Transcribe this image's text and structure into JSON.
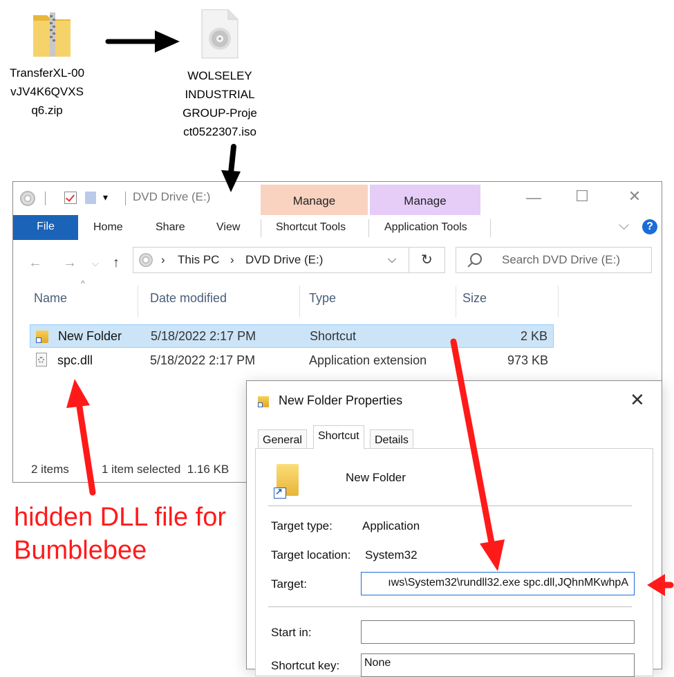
{
  "desktop": {
    "zip_label_lines": [
      "TransferXL-00",
      "vJV4K6QVXS",
      "q6.zip"
    ],
    "iso_label_lines": [
      "WOLSELEY",
      "INDUSTRIAL",
      "GROUP-Proje",
      "ct0522307.iso"
    ]
  },
  "explorer": {
    "title": "DVD Drive (E:)",
    "context_tabs": [
      {
        "header": "Manage",
        "tab": "Shortcut Tools",
        "color": "#f9d2c0"
      },
      {
        "header": "Manage",
        "tab": "Application Tools",
        "color": "#e6cdf7"
      }
    ],
    "ribbon_tabs": [
      "File",
      "Home",
      "Share",
      "View"
    ],
    "breadcrumb": [
      "This PC",
      "DVD Drive (E:)"
    ],
    "search_placeholder": "Search DVD Drive (E:)",
    "columns": [
      "Name",
      "Date modified",
      "Type",
      "Size"
    ],
    "files": [
      {
        "name": "New Folder",
        "date": "5/18/2022 2:17 PM",
        "type": "Shortcut",
        "size": "2 KB",
        "selected": true,
        "icon": "shortcut-folder-icon"
      },
      {
        "name": "spc.dll",
        "date": "5/18/2022 2:17 PM",
        "type": "Application extension",
        "size": "973 KB",
        "selected": false,
        "icon": "dll-file-icon"
      }
    ],
    "status": {
      "items": "2 items",
      "selected": "1 item selected  1.16 KB"
    }
  },
  "dialog": {
    "title": "New Folder Properties",
    "tabs": [
      "General",
      "Shortcut",
      "Details"
    ],
    "active_tab": "Shortcut",
    "name": "New Folder",
    "target_type_label": "Target type:",
    "target_type_value": "Application",
    "target_location_label": "Target location:",
    "target_location_value": "System32",
    "target_label": "Target:",
    "target_value": "ıws\\System32\\rundll32.exe spc.dll,JQhnMKwhpA",
    "start_in_label": "Start in:",
    "start_in_value": "",
    "shortcut_key_label": "Shortcut key:",
    "shortcut_key_value": "None"
  },
  "annotation": {
    "lines": [
      "hidden DLL file for",
      "Bumblebee"
    ],
    "color": "#ff1a1a"
  }
}
